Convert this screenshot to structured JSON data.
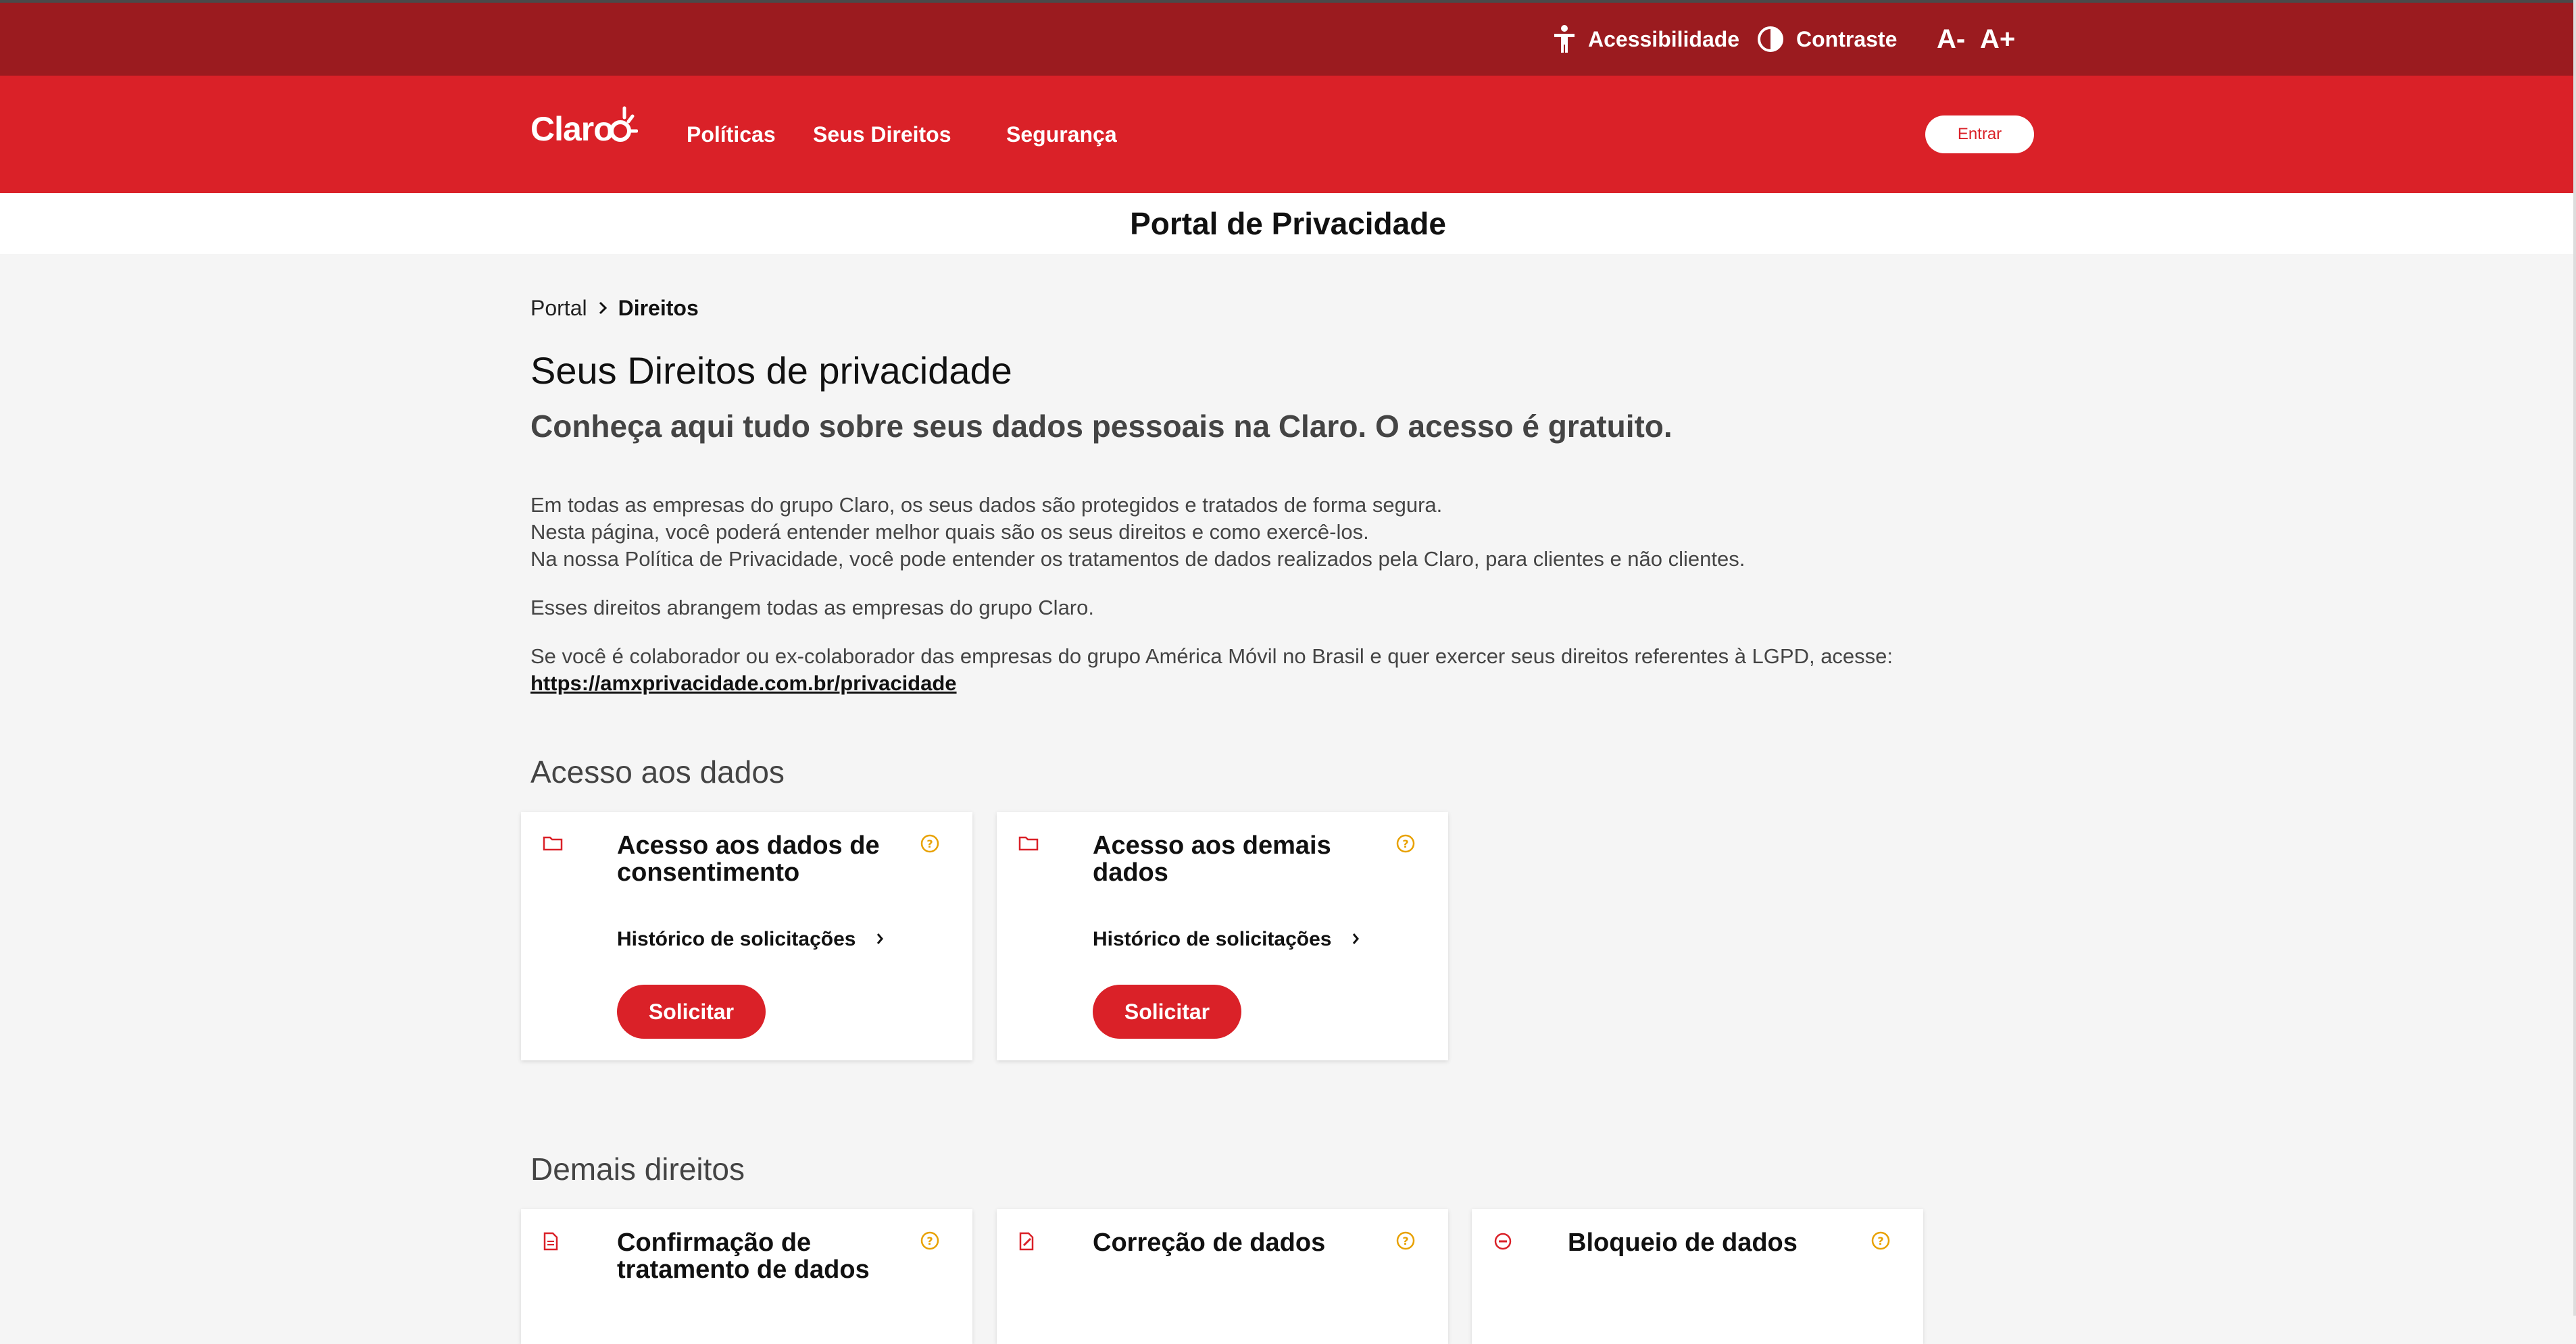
{
  "utility": {
    "accessibility": "Acessibilidade",
    "contrast": "Contraste",
    "font_decrease": "A-",
    "font_increase": "A+"
  },
  "nav": {
    "logo": "Claro",
    "links": [
      "Políticas",
      "Seus Direitos",
      "Segurança"
    ],
    "login": "Entrar"
  },
  "page_title": "Portal de Privacidade",
  "breadcrumb": {
    "root": "Portal",
    "current": "Direitos"
  },
  "main": {
    "heading": "Seus Direitos de privacidade",
    "subheading": "Conheça aqui tudo sobre seus dados pessoais na Claro. O acesso é gratuito.",
    "intro_lines": [
      "Em todas as empresas do grupo Claro, os seus dados são protegidos e tratados de forma segura.",
      "Nesta página, você poderá entender melhor quais são os seus direitos e como exercê-los.",
      "Na nossa Política de Privacidade, você pode entender os tratamentos de dados realizados pela Claro, para clientes e não clientes."
    ],
    "scope_text": "Esses direitos abrangem todas as empresas do grupo Claro.",
    "collaborator_text": "Se você é colaborador ou ex-colaborador das empresas do grupo América Móvil no Brasil e quer exercer seus direitos referentes à LGPD, acesse:",
    "collaborator_link": "https://amxprivacidade.com.br/privacidade"
  },
  "section_access": {
    "title": "Acesso aos dados",
    "cards": [
      {
        "title": "Acesso aos dados de consentimento",
        "history": "Histórico de solicitações",
        "button": "Solicitar"
      },
      {
        "title": "Acesso aos demais dados",
        "history": "Histórico de solicitações",
        "button": "Solicitar"
      }
    ]
  },
  "section_other": {
    "title": "Demais direitos",
    "cards": [
      {
        "title": "Confirmação de tratamento de dados"
      },
      {
        "title": "Correção de dados"
      },
      {
        "title": "Bloqueio de dados"
      }
    ]
  },
  "colors": {
    "brand_red": "#da2128",
    "dark_red": "#9b1b1f",
    "help_orange": "#e8a100"
  }
}
